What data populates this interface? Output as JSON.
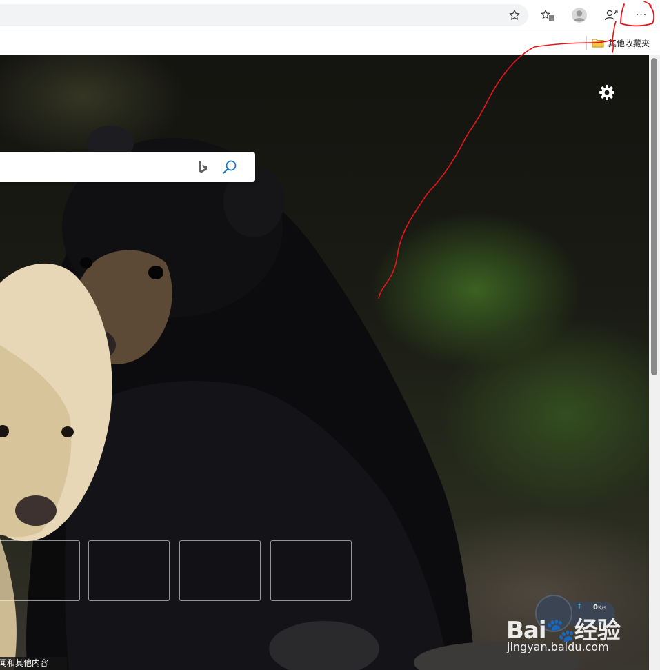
{
  "toolbar": {
    "icons": [
      "star-add-icon",
      "favorites-icon",
      "profile-avatar-icon",
      "share-person-icon",
      "more-menu-icon"
    ],
    "more_label": "···"
  },
  "favorites_bar": {
    "folder_label": "其他收藏夹",
    "folder_icon": "folder-icon"
  },
  "newtab": {
    "search_placeholder": "",
    "bing_icon": "bing-logo-icon",
    "search_icon": "search-icon",
    "settings_icon": "gear-icon",
    "quick_links": [
      {
        "label": ""
      },
      {
        "label": ""
      },
      {
        "label": ""
      },
      {
        "label": ""
      }
    ],
    "news_text": "新闻和其他内容"
  },
  "speed_widget": {
    "up_arrow": "↑",
    "value": "0",
    "unit": "K/s"
  },
  "watermark": {
    "logo": "Bai🐾经验",
    "url": "jingyan.baidu.com"
  },
  "colors": {
    "annotation_red": "#e8141c",
    "toolbar_bg": "#ffffff",
    "folder_yellow": "#f4c542"
  }
}
